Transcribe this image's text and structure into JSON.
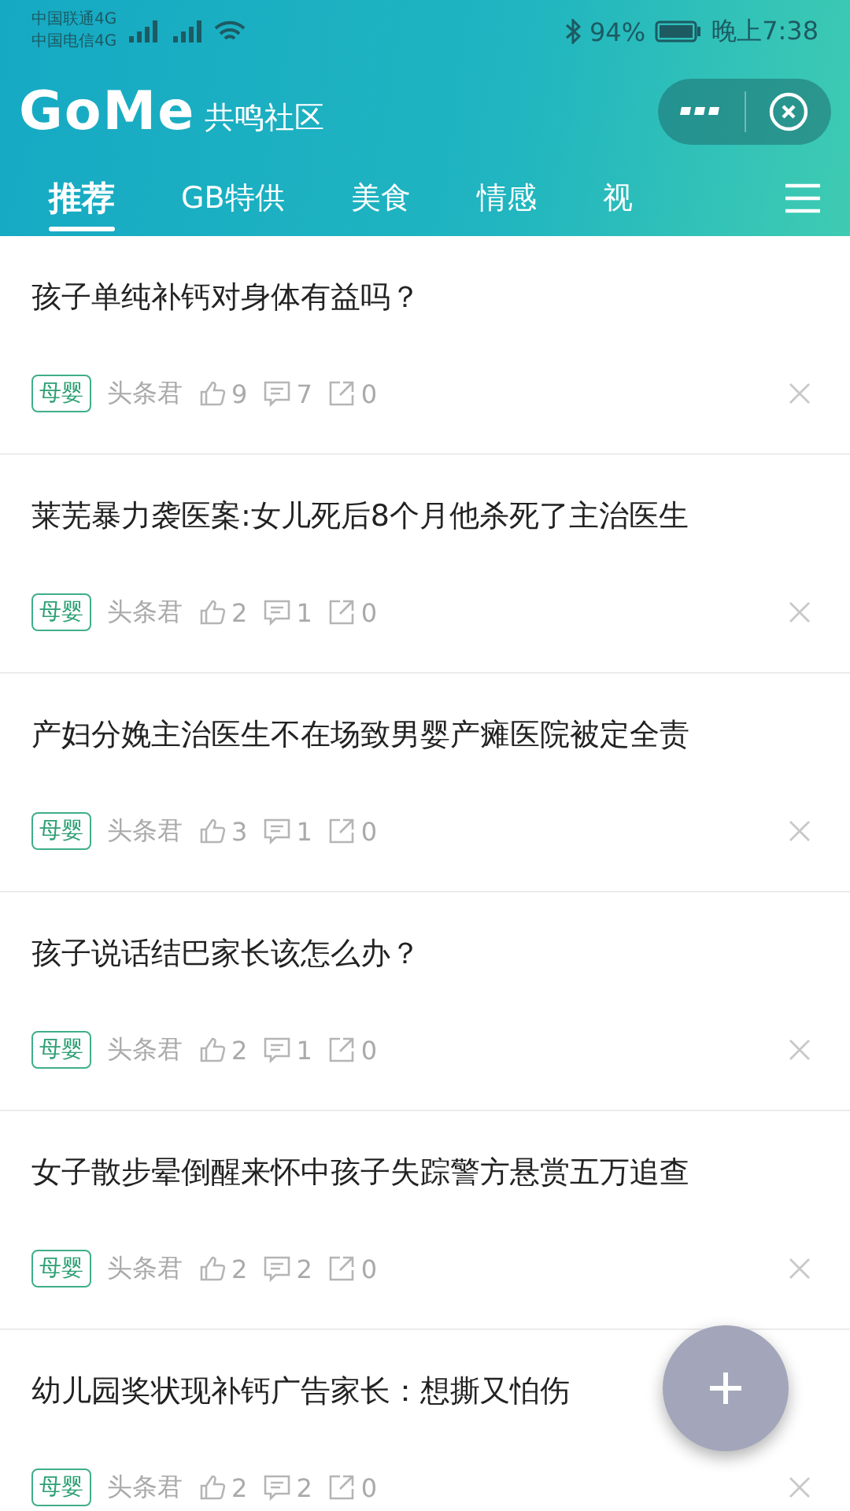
{
  "status_bar": {
    "carriers": [
      "中国联通4G",
      "中国电信4G"
    ],
    "battery": "94%",
    "time": "晚上7:38"
  },
  "header": {
    "logo": "GoMe",
    "subtitle": "共鸣社区"
  },
  "tabs": [
    {
      "label": "推荐",
      "selected": true
    },
    {
      "label": "GB特供",
      "selected": false
    },
    {
      "label": "美食",
      "selected": false
    },
    {
      "label": "情感",
      "selected": false
    },
    {
      "label": "视",
      "selected": false
    }
  ],
  "articles": [
    {
      "title": "孩子单纯补钙对身体有益吗？",
      "tag": "母婴",
      "author": "头条君",
      "likes": "9",
      "comments": "7",
      "shares": "0"
    },
    {
      "title": "莱芜暴力袭医案:女儿死后8个月他杀死了主治医生",
      "tag": "母婴",
      "author": "头条君",
      "likes": "2",
      "comments": "1",
      "shares": "0"
    },
    {
      "title": "产妇分娩主治医生不在场致男婴产瘫医院被定全责",
      "tag": "母婴",
      "author": "头条君",
      "likes": "3",
      "comments": "1",
      "shares": "0"
    },
    {
      "title": "孩子说话结巴家长该怎么办？",
      "tag": "母婴",
      "author": "头条君",
      "likes": "2",
      "comments": "1",
      "shares": "0"
    },
    {
      "title": "女子散步晕倒醒来怀中孩子失踪警方悬赏五万追查",
      "tag": "母婴",
      "author": "头条君",
      "likes": "2",
      "comments": "2",
      "shares": "0"
    },
    {
      "title": "幼儿园奖状现补钙广告家长：想撕又怕伤",
      "tag": "母婴",
      "author": "头条君",
      "likes": "2",
      "comments": "2",
      "shares": "0"
    }
  ]
}
